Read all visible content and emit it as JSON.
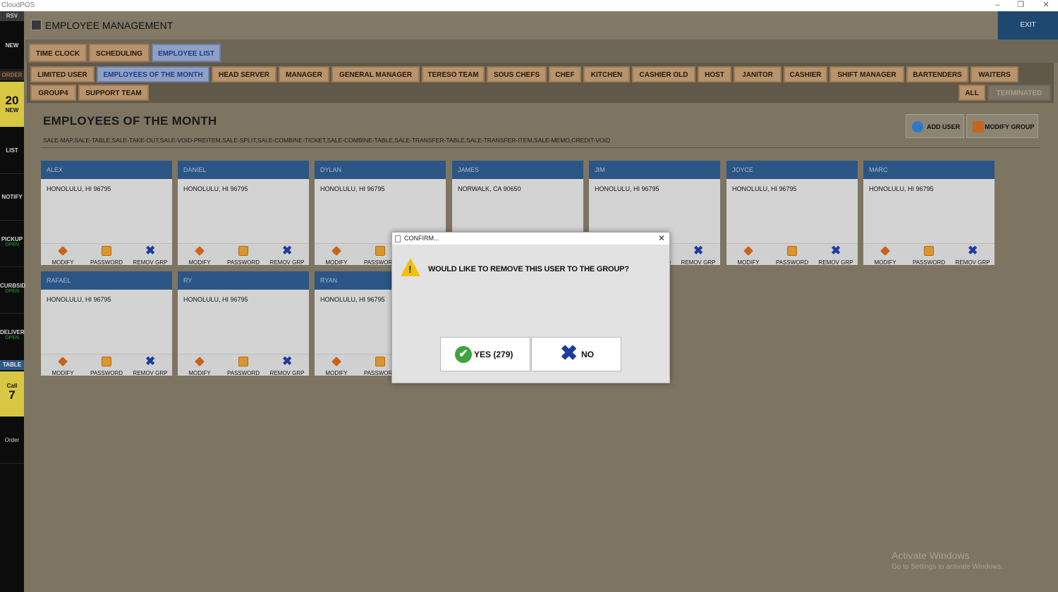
{
  "window": {
    "app_title": "CloudPOS"
  },
  "sidebar": {
    "rsv": "RSV",
    "new": "NEW",
    "order": "ORDER",
    "count_new": {
      "count": "20",
      "label": "NEW"
    },
    "list": "LIST",
    "notify": "NOTIFY",
    "pickup": {
      "label": "PICKUP",
      "status": "OPEN"
    },
    "curbside": {
      "label": "CURBSID",
      "status": "OPEN"
    },
    "delivery": {
      "label": "DELIVER",
      "status": "OPEN"
    },
    "table": "TABLE",
    "call": {
      "label": "Call",
      "count": "7"
    },
    "order_bottom": "Order"
  },
  "header": {
    "title": "EMPLOYEE MANAGEMENT",
    "exit_label": "EXIT"
  },
  "main_tabs": [
    "TIME CLOCK",
    "SCHEDULING",
    "EMPLOYEE LIST"
  ],
  "groups_row1": [
    "LIMITED USER",
    "EMPLOYEES OF THE MONTH",
    "HEAD SERVER",
    "MANAGER",
    "GENERAL MANAGER",
    "TERESO TEAM",
    "SOUS CHEFS",
    "CHEF",
    "KITCHEN",
    "CASHIER OLD",
    "HOST",
    "JANITOR",
    "CASHIER",
    "SHIFT MANAGER",
    "BARTENDERS",
    "WAITERS"
  ],
  "groups_row2": [
    "GROUP4",
    "SUPPORT TEAM"
  ],
  "filters": {
    "all": "ALL",
    "terminated": "TERMINATED"
  },
  "page": {
    "title": "EMPLOYEES OF THE MONTH",
    "permissions": "SALE-MAP,SALE-TABLE,SALE-TAKE-OUT,SALE-VOID-PREITEM,SALE-SPLIT,SALE-COMBINE-TICKET,SALE-COMBINE-TABLE,SALE-TRANSFER-TABLE,SALE-TRANSFER-ITEM,SALE-MEMO,CREDIT-VOID",
    "add_user": "ADD USER",
    "modify_group": "MODIFY GROUP"
  },
  "card_actions": {
    "modify": "MODIFY",
    "password": "PASSWORD",
    "remove": "REMOV GRP"
  },
  "employees": [
    {
      "name": "ALEX",
      "address": "HONOLULU, HI 96795"
    },
    {
      "name": "DANIEL",
      "address": "HONOLULU, HI 96795"
    },
    {
      "name": "DYLAN",
      "address": "HONOLULU, HI 96795"
    },
    {
      "name": "JAMES",
      "address": "NORWALK, CA 90650"
    },
    {
      "name": "JIM",
      "address": "HONOLULU, HI 96795"
    },
    {
      "name": "JOYCE",
      "address": "HONOLULU, HI 96795"
    },
    {
      "name": "MARC",
      "address": "HONOLULU, HI 96795"
    },
    {
      "name": "RAFAEL",
      "address": "HONOLULU, HI 96795"
    },
    {
      "name": "RY",
      "address": "HONOLULU, HI 96795"
    },
    {
      "name": "RYAN",
      "address": "HONOLULU, HI 96795"
    }
  ],
  "dialog": {
    "title": "CONFIRM...",
    "message": "WOULD LIKE TO REMOVE THIS USER TO THE GROUP?",
    "yes_label": "YES (279)",
    "no_label": "NO"
  },
  "watermark": {
    "line1": "Activate Windows",
    "line2": "Go to Settings to activate Windows."
  }
}
